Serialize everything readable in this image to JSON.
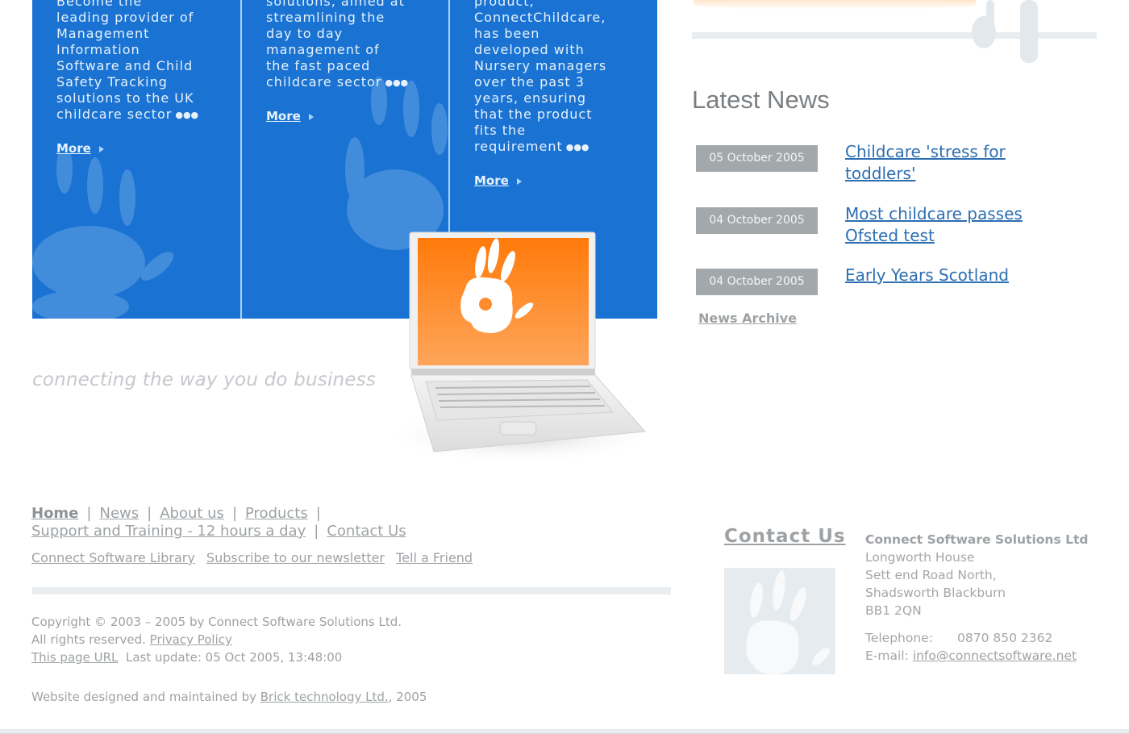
{
  "promo": [
    {
      "text": "Become the\nleading provider of\nManagement\nInformation\nSoftware and Child\nSafety Tracking\nsolutions to the UK\nchildcare sector",
      "ellipsis": "●●●",
      "more_label": "More"
    },
    {
      "text": "solutions, aimed at\nstreamlining the\nday to day\nmanagement of\nthe fast paced\nchildcare sector",
      "ellipsis": "●●●",
      "more_label": "More"
    },
    {
      "text": "product,\nConnectChildcare,\nhas been\ndeveloped with\nNursery managers\nover the past 3\nyears, ensuring\nthat the product\nfits the\nrequirement",
      "ellipsis": "●●●",
      "more_label": "More"
    }
  ],
  "tagline": "connecting the way you do business",
  "news": {
    "heading": "Latest News",
    "items": [
      {
        "date": "05 October 2005",
        "title": "Childcare 'stress for toddlers'"
      },
      {
        "date": "04 October 2005",
        "title": "Most childcare passes Ofsted test"
      },
      {
        "date": "04 October 2005",
        "title": "Early Years Scotland"
      }
    ],
    "archive_label": "News Archive"
  },
  "footer": {
    "nav": {
      "home": "Home",
      "news": "News",
      "about": "About us",
      "products": "Products",
      "support": "Support and Training - 12 hours a day",
      "contact": "Contact Us",
      "separator": "|"
    },
    "links": {
      "library": "Connect Software Library",
      "newsletter": "Subscribe to our newsletter",
      "tell_friend": "Tell a Friend"
    },
    "copyright_line": "Copyright © 2003 – 2005 by Connect Software Solutions Ltd.",
    "rights_text": "All rights reserved.",
    "privacy_label": "Privacy Policy",
    "page_url_label": "This page URL",
    "last_update": "Last update: 05 Oct 2005, 13:48:00",
    "designed_prefix": "Website designed and maintained by",
    "designer_link": "Brick technology Ltd.",
    "designed_suffix": ", 2005"
  },
  "contact": {
    "heading": "Contact Us",
    "company": "Connect Software Solutions Ltd",
    "address": [
      "Longworth House",
      "Sett end Road North,",
      "Shadsworth Blackburn",
      "BB1 2QN"
    ],
    "phone_label": "Telephone:",
    "phone": "0870 850 2362",
    "email_label": "E-mail:",
    "email": "info@connectsoftware.net"
  },
  "colors": {
    "promo_blue": "#1a73d2",
    "screen_orange": "#ff7a12",
    "news_link": "#2e6fb2",
    "date_badge": "#a3a9ab",
    "muted_text": "#9ea2a5"
  }
}
